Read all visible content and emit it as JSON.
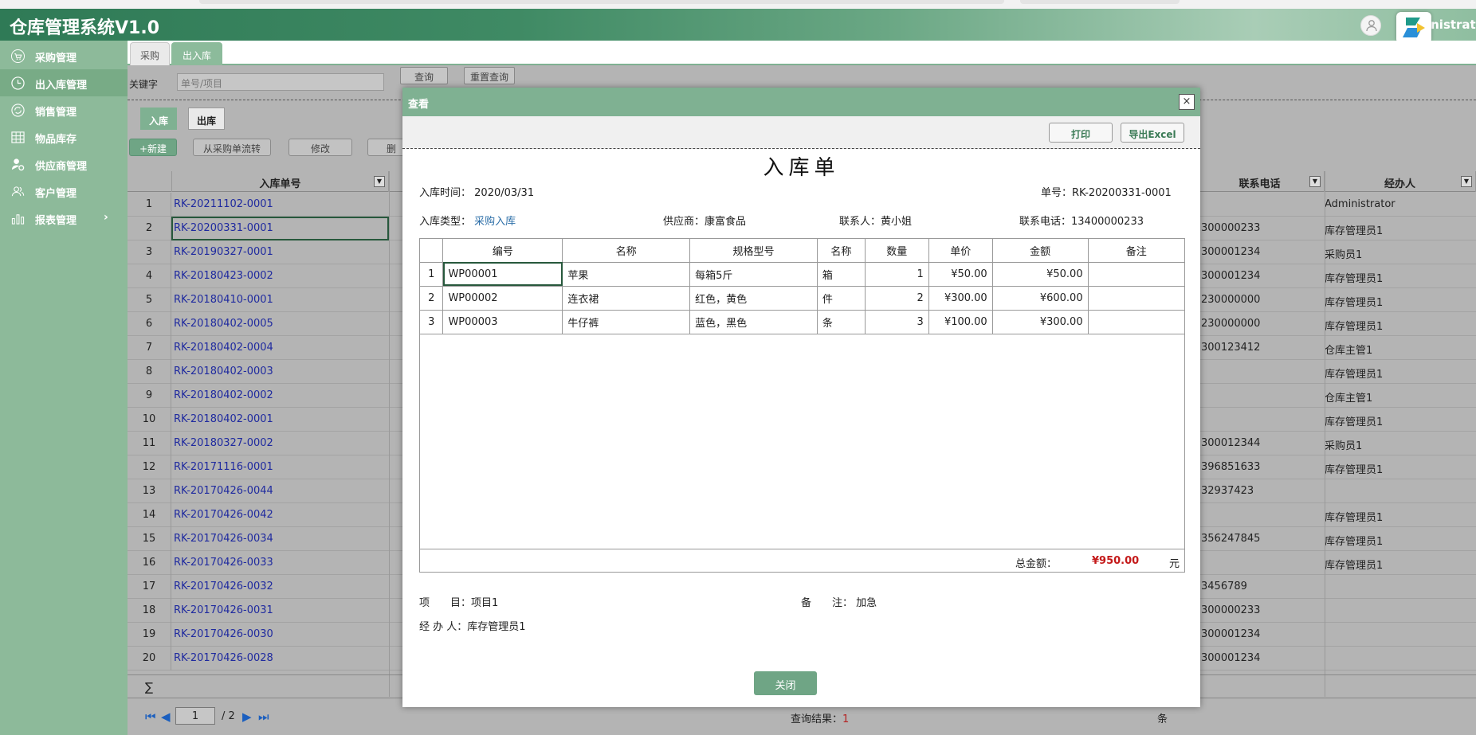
{
  "app": {
    "title": "仓库管理系统V1.0",
    "user": "Administrator"
  },
  "sidebar": {
    "items": [
      {
        "label": "采购管理",
        "icon": "cart-icon"
      },
      {
        "label": "出入库管理",
        "icon": "clock-icon"
      },
      {
        "label": "销售管理",
        "icon": "refresh-icon"
      },
      {
        "label": "物品库存",
        "icon": "grid-icon"
      },
      {
        "label": "供应商管理",
        "icon": "user-settings-icon"
      },
      {
        "label": "客户管理",
        "icon": "users-icon"
      },
      {
        "label": "报表管理",
        "icon": "bar-chart-icon"
      }
    ],
    "active_index": 1
  },
  "tabs": [
    {
      "label": "采购"
    },
    {
      "label": "出入库"
    }
  ],
  "search": {
    "label": "关键字",
    "placeholder": "单号/项目",
    "query_button": "查询",
    "reset_button": "重置查询"
  },
  "inout": {
    "in_label": "入库",
    "out_label": "出库"
  },
  "toolbar": {
    "new_label": "+新建",
    "from_purchase_label": "从采购单流转",
    "edit_label": "修改",
    "delete_label": "删"
  },
  "grid": {
    "columns": {
      "code": "入库单号",
      "phone": "联系电话",
      "agent": "经办人"
    },
    "rows": [
      {
        "no": "1",
        "code": "RK-20211102-0001",
        "phone": "",
        "agent": "Administrator"
      },
      {
        "no": "2",
        "code": "RK-20200331-0001",
        "phone": "300000233",
        "agent": "库存管理员1"
      },
      {
        "no": "3",
        "code": "RK-20190327-0001",
        "phone": "300001234",
        "agent": "采购员1"
      },
      {
        "no": "4",
        "code": "RK-20180423-0002",
        "phone": "300001234",
        "agent": "库存管理员1"
      },
      {
        "no": "5",
        "code": "RK-20180410-0001",
        "phone": "230000000",
        "agent": "库存管理员1"
      },
      {
        "no": "6",
        "code": "RK-20180402-0005",
        "phone": "230000000",
        "agent": "库存管理员1"
      },
      {
        "no": "7",
        "code": "RK-20180402-0004",
        "phone": "300123412",
        "agent": "仓库主管1"
      },
      {
        "no": "8",
        "code": "RK-20180402-0003",
        "phone": "",
        "agent": "库存管理员1"
      },
      {
        "no": "9",
        "code": "RK-20180402-0002",
        "phone": "",
        "agent": "仓库主管1"
      },
      {
        "no": "10",
        "code": "RK-20180402-0001",
        "phone": "",
        "agent": "库存管理员1"
      },
      {
        "no": "11",
        "code": "RK-20180327-0002",
        "phone": "300012344",
        "agent": "采购员1"
      },
      {
        "no": "12",
        "code": "RK-20171116-0001",
        "phone": "396851633",
        "agent": "库存管理员1"
      },
      {
        "no": "13",
        "code": "RK-20170426-0044",
        "phone": "32937423",
        "agent": ""
      },
      {
        "no": "14",
        "code": "RK-20170426-0042",
        "phone": "",
        "agent": "库存管理员1"
      },
      {
        "no": "15",
        "code": "RK-20170426-0034",
        "phone": "356247845",
        "agent": "库存管理员1"
      },
      {
        "no": "16",
        "code": "RK-20170426-0033",
        "phone": "",
        "agent": "库存管理员1"
      },
      {
        "no": "17",
        "code": "RK-20170426-0032",
        "phone": "3456789",
        "agent": ""
      },
      {
        "no": "18",
        "code": "RK-20170426-0031",
        "phone": "300000233",
        "agent": ""
      },
      {
        "no": "19",
        "code": "RK-20170426-0030",
        "phone": "300001234",
        "agent": ""
      },
      {
        "no": "20",
        "code": "RK-20170426-0028",
        "phone": "300001234",
        "agent": ""
      }
    ],
    "selected_index": 1,
    "sum_symbol": "∑"
  },
  "pager": {
    "page": "1",
    "total": "/ 2",
    "result_label": "查询结果：",
    "result_count": "1",
    "result_unit": "条"
  },
  "modal": {
    "title": "查看",
    "close_x": "×",
    "print_label": "打印",
    "export_label": "导出Excel",
    "doc_title": "入库单",
    "time_label": "入库时间：",
    "time_value": "2020/03/31",
    "order_no": "单号：RK-20200331-0001",
    "type_label": "入库类型：",
    "type_value": "采购入库",
    "supplier": "供应商：康富食品",
    "contact": "联系人：黄小姐",
    "contact_phone": "联系电话：13400000233",
    "item_columns": [
      "编号",
      "名称",
      "规格型号",
      "名称",
      "数量",
      "单价",
      "金额",
      "备注"
    ],
    "items": [
      {
        "no": "1",
        "code": "WP00001",
        "name": "苹果",
        "spec": "每箱5斤",
        "unit": "箱",
        "qty": "1",
        "price": "¥50.00",
        "amount": "¥50.00",
        "remark": ""
      },
      {
        "no": "2",
        "code": "WP00002",
        "name": "连衣裙",
        "spec": "红色，黄色",
        "unit": "件",
        "qty": "2",
        "price": "¥300.00",
        "amount": "¥600.00",
        "remark": ""
      },
      {
        "no": "3",
        "code": "WP00003",
        "name": "牛仔裤",
        "spec": "蓝色，黑色",
        "unit": "条",
        "qty": "3",
        "price": "¥100.00",
        "amount": "¥300.00",
        "remark": ""
      }
    ],
    "total_label": "总金额：",
    "total_value": "¥950.00",
    "total_unit": "元",
    "project": "项　　目：项目1",
    "remark": "备　　注：  加急",
    "handler": "经  办  人：库存管理员1",
    "close_button": "关闭"
  }
}
